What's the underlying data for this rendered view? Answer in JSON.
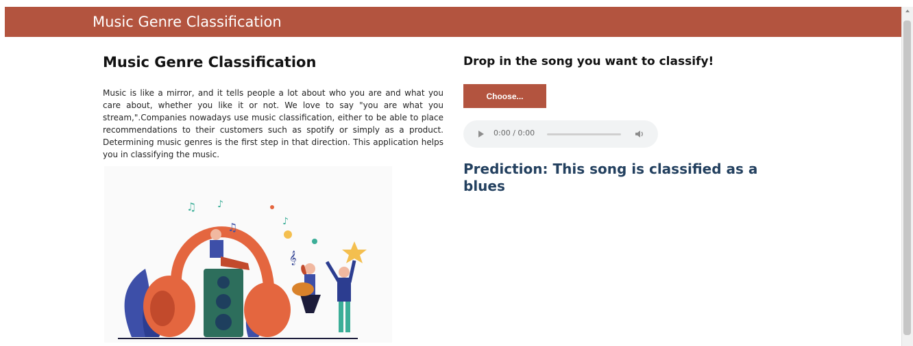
{
  "header": {
    "title": "Music Genre Classification",
    "bg_color": "#b3543f"
  },
  "left": {
    "heading": "Music Genre Classification",
    "description": "Music is like a mirror, and it tells people a lot about who you are and what you care about, whether you like it or not. We love to say \"you are what you stream,\".Companies nowadays use music classification, either to be able to place recommendations to their customers such as spotify or simply as a product. Determining music genres is the first step in that direction. This application helps you in classifying the music.",
    "illustration_icon": "music-headphones-illustration"
  },
  "right": {
    "heading": "Drop in the song you want to classify!",
    "choose_label": "Choose...",
    "audio": {
      "time": "0:00 / 0:00",
      "progress": 0
    },
    "prediction": "Prediction: This song is classified as a blues"
  }
}
